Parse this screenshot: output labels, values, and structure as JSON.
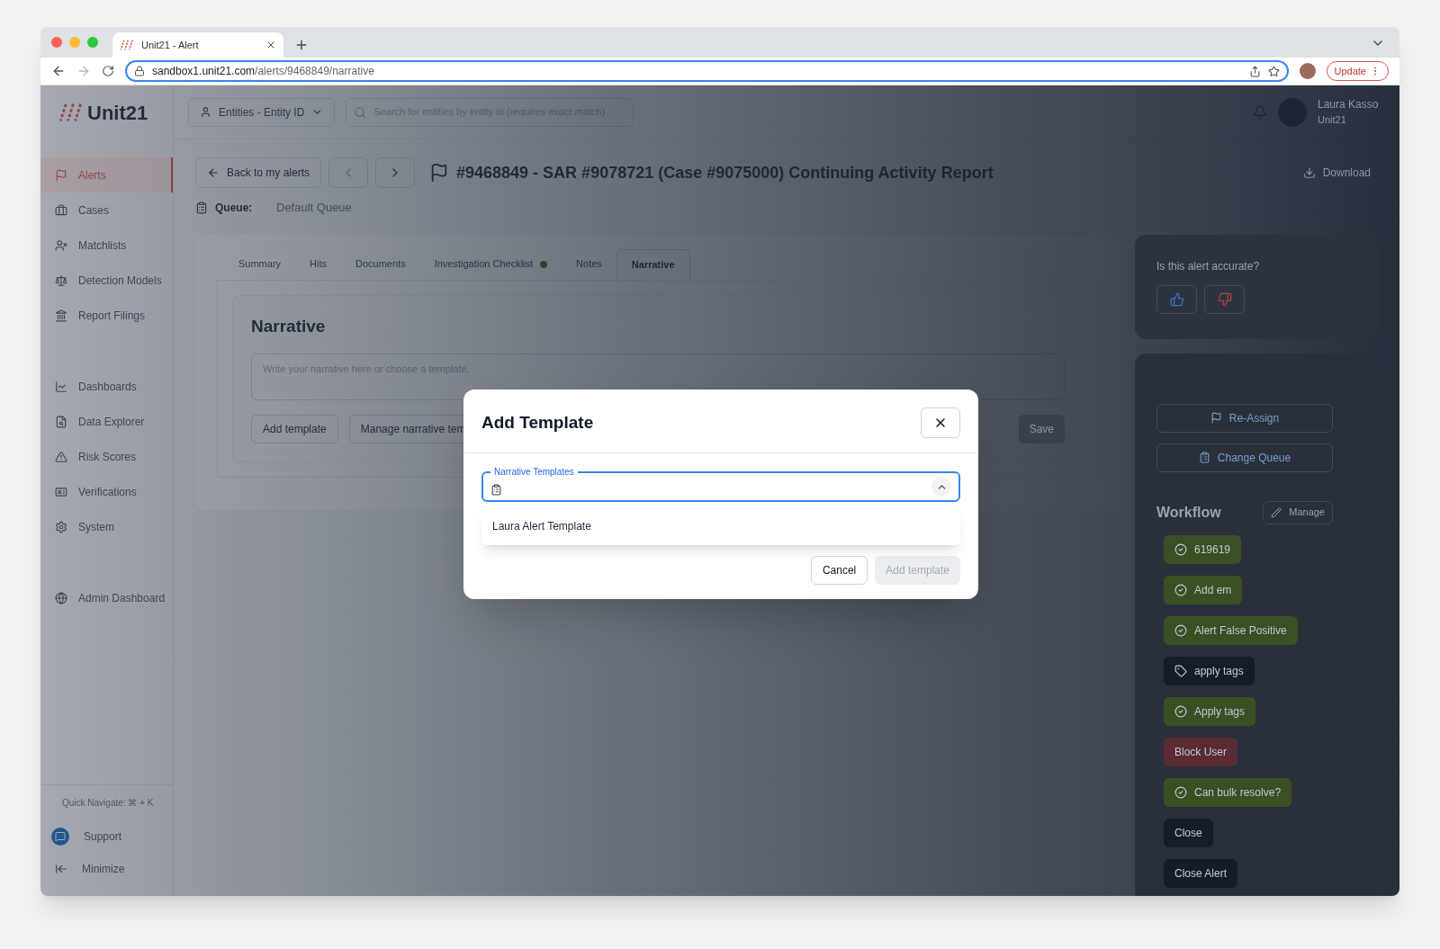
{
  "browser": {
    "tab_title": "Unit21 - Alert",
    "url_host": "sandbox1.unit21.com",
    "url_path": "/alerts/9468849/narrative",
    "update_label": "Update"
  },
  "brand": {
    "name": "Unit21"
  },
  "sidebar": {
    "groups": [
      {
        "items": [
          {
            "label": "Alerts",
            "selected": true
          },
          {
            "label": "Cases",
            "selected": false
          },
          {
            "label": "Matchlists",
            "selected": false
          },
          {
            "label": "Detection Models",
            "selected": false
          },
          {
            "label": "Report Filings",
            "selected": false
          }
        ]
      },
      {
        "items": [
          {
            "label": "Dashboards",
            "selected": false
          },
          {
            "label": "Data Explorer",
            "selected": false
          },
          {
            "label": "Risk Scores",
            "selected": false
          },
          {
            "label": "Verifications",
            "selected": false
          },
          {
            "label": "System",
            "selected": false
          }
        ]
      },
      {
        "items": [
          {
            "label": "Admin Dashboard",
            "selected": false
          }
        ]
      }
    ],
    "quick_navigate": "Quick Navigate: ⌘ + K",
    "support": "Support",
    "minimize": "Minimize"
  },
  "header": {
    "entity_select": "Entities - Entity ID",
    "search_placeholder": "Search for entities by entity id (requires exact match)",
    "user_name": "Laura Kasso",
    "user_org": "Unit21"
  },
  "alert": {
    "back": "Back to my alerts",
    "title": "#9468849 - SAR #9078721 (Case #9075000) Continuing Activity Report",
    "download": "Download",
    "queue_label": "Queue:",
    "queue_value": "Default Queue"
  },
  "tabs": [
    {
      "label": "Summary",
      "selected": false
    },
    {
      "label": "Hits",
      "selected": false
    },
    {
      "label": "Documents",
      "selected": false
    },
    {
      "label": "Investigation Checklist",
      "selected": false,
      "has_dot": true
    },
    {
      "label": "Notes",
      "selected": false
    },
    {
      "label": "Narrative",
      "selected": true
    }
  ],
  "narrative": {
    "heading": "Narrative",
    "placeholder": "Write your narrative here or choose a template.",
    "buttons": [
      "Add template",
      "Manage narrative tem"
    ],
    "save": "Save"
  },
  "accuracy": {
    "question": "Is this alert accurate?"
  },
  "actions": [
    "Re-Assign",
    "Change Queue"
  ],
  "workflow": {
    "title": "Workflow",
    "manage": "Manage",
    "buttons": [
      {
        "label": "619619",
        "kind": "check",
        "color": "#3b4f24"
      },
      {
        "label": "Add em",
        "kind": "check",
        "color": "#3b4f24"
      },
      {
        "label": "Alert False Positive",
        "kind": "check",
        "color": "#3b4f24"
      },
      {
        "label": "apply tags",
        "kind": "tag",
        "color": "#161d29"
      },
      {
        "label": "Apply tags",
        "kind": "check",
        "color": "#3b4f24"
      },
      {
        "label": "Block User",
        "kind": "plain",
        "color": "#5a2b33"
      },
      {
        "label": "Can bulk resolve?",
        "kind": "check",
        "color": "#3b4f24"
      },
      {
        "label": "Close",
        "kind": "plain",
        "color": "#161d29"
      },
      {
        "label": "Close Alert",
        "kind": "plain",
        "color": "#161d29"
      }
    ]
  },
  "modal": {
    "title": "Add Template",
    "field_label": "Narrative Templates",
    "expanded": true,
    "options": [
      "Laura Alert Template"
    ],
    "cancel": "Cancel",
    "submit": "Add template",
    "submit_disabled": true
  }
}
